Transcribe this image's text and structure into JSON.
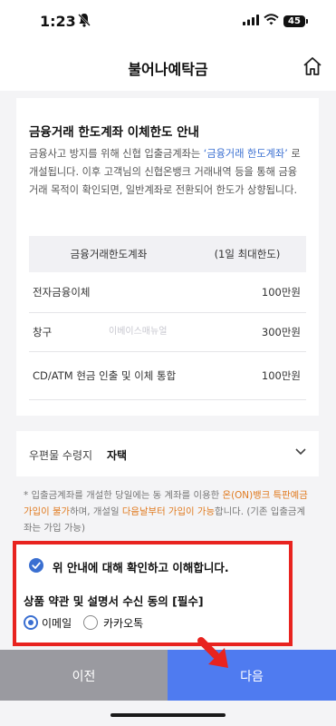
{
  "status": {
    "time": "1:23",
    "battery": "45"
  },
  "header": {
    "title": "불어나예탁금"
  },
  "notice": {
    "title": "금융거래 한도계좌 이체한도 안내",
    "text_before": "금융사고 방지를 위해 신협 입출금계좌는 ",
    "text_highlight": "‘금융거래 한도계좌’",
    "text_after": " 로 개설됩니다. 이후 고객님의 신협온뱅크 거래내역 등을 통해 금융거래 목적이 확인되면, 일반계좌로 전환되어 한도가 상향됩니다."
  },
  "limit_table": {
    "headers": [
      "금융거래한도계좌",
      "(1일 최대한도)"
    ],
    "rows": [
      {
        "type": "전자금융이체",
        "limit": "100만원"
      },
      {
        "type": "창구",
        "limit": "300만원"
      },
      {
        "type": "CD/ATM 현금 인출 및 이체 통합",
        "limit": "100만원"
      }
    ]
  },
  "watermark": "이베이스매뉴얼",
  "mail": {
    "label": "우편물 수령지",
    "value": "자택"
  },
  "footnote": {
    "part1": "* 입출금계좌를 개설한 당일에는 동 계좌를 이용한 ",
    "part2": "온(ON)뱅크 특판예금 가입이 불가",
    "part3": "하며, 개설일 ",
    "part4": "다음날부터 가입이 가능",
    "part5": "합니다. (기존 입출금계좌는 가입 가능)"
  },
  "agree": {
    "confirm_text": "위 안내에 대해 확인하고 이해합니다.",
    "consent_title": "상품 약관 및 설명서 수신 동의 [필수]",
    "options": [
      "이메일",
      "카카오톡"
    ],
    "selected": "이메일"
  },
  "buttons": {
    "prev": "이전",
    "next": "다음"
  },
  "colors": {
    "accent": "#4f7bf0",
    "highlight_box": "#e8231f",
    "orange": "#e07a1f"
  }
}
